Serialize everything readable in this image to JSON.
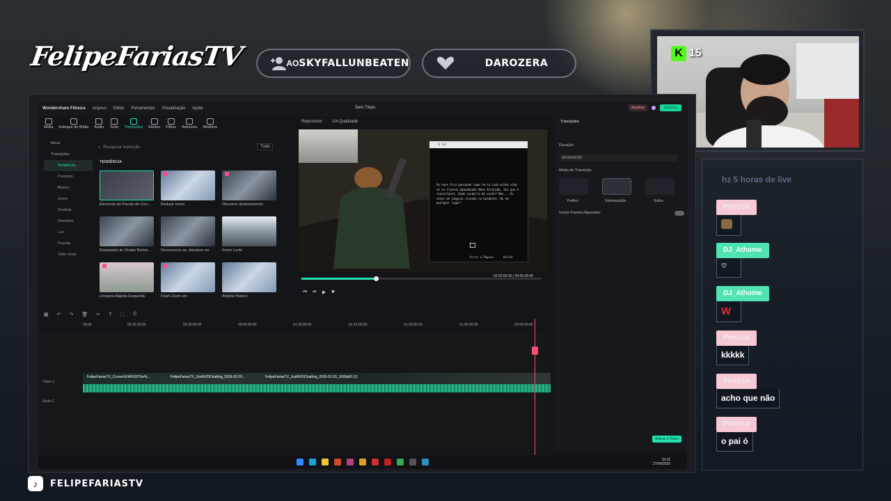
{
  "overlay": {
    "logo": "FelipeFariasTV",
    "sub_pill_prefix": "AO",
    "sub_pill_name": "SKYFALLUNBEATEN",
    "follow_pill_name": "DAROZERA",
    "kick_count": "15",
    "tiktok_handle": "FELIPEFARIASTV"
  },
  "editor": {
    "app_name": "Wondershare Filmora",
    "menu": [
      "Arquivo",
      "Editar",
      "Ferramentas",
      "Visualização",
      "Ajuda"
    ],
    "title": "Sem Título",
    "update_btn": "Atualizar",
    "export_btn": "Exportar",
    "tools": [
      "Mídia",
      "Estoque de Mídia",
      "Áudio",
      "Texto",
      "Transições",
      "Efeitos",
      "Filtros",
      "Adesivos",
      "Modelos"
    ],
    "active_tool": "Transições",
    "nav": {
      "mine": "Meus",
      "transitions": "Transições",
      "items": [
        "Tendência",
        "Premium",
        "Básico",
        "Zoom",
        "Deslizar",
        "Dissolver",
        "Luz",
        "Popular",
        "Slide show"
      ]
    },
    "search_placeholder": "Pesquisar transição",
    "search_filter": "Tudo",
    "section_title": "TENDÊNCIA",
    "tiles": [
      {
        "label": "Elemento do Pacote de Con..."
      },
      {
        "label": "Reduzir zoom"
      },
      {
        "label": "Dissolver desbotamento"
      },
      {
        "label": "Rastejador de Ondas Borbol..."
      },
      {
        "label": "Desvanecer-se, dissolver-se"
      },
      {
        "label": "Zoom Lento"
      },
      {
        "label": "Limpeza Rápida Esquerda"
      },
      {
        "label": "Flash Zoom em"
      },
      {
        "label": "Ampliar Básico"
      }
    ],
    "player": {
      "label": "Reprodutor",
      "quality": "1/4 Qualidade",
      "current": "02:02:56:06",
      "total": "/ 04:55:49:40",
      "popup_title": "- E Se?",
      "popup_text": "Se voce fica pensando como teria sido minha vida se eu tivesse abandonado Nova Alvorada. Sei que e inaceitável. Quem cuidaria de vocês? Mas... Às vezes me imagino vivendo no Guidente. Ou em qualquer lugar!",
      "popup_opt1": "Virar a Página",
      "popup_opt2": "Voltar"
    },
    "right_panel": {
      "tab": "Transições",
      "duration_label": "Duração",
      "duration_value": "00:00:00:52",
      "mode_label": "Modo de Transição",
      "modes": [
        "Prefixo",
        "Sobreposição",
        "Sufixo"
      ],
      "include_label": "Incluir Frames Aparados",
      "apply_all": "Aplicar a Todos"
    },
    "ruler": [
      "00:00",
      "00:15:00:00",
      "00:30:00:00",
      "00:45:00:00",
      "01:00:00:00",
      "01:15:00:00",
      "01:30:00:00",
      "01:45:00:00",
      "02:00:00:00"
    ],
    "clips": [
      "FelipeFariasTV_Cronos%3A%20The%...",
      "FelipeFariasTV_Just%20Chatting_2026-02-20...",
      "FelipeFariasTV_Just%20Chatting_2026-02-20_1080p60 (2)"
    ],
    "track_video": "Vídeo 1",
    "track_audio": "Áudio 1",
    "clock_time": "15:42",
    "clock_date": "27/04/2026"
  },
  "chat": {
    "top_text": "hz 5 horas de live",
    "messages": [
      {
        "user": "Phozi1a",
        "text": "",
        "kind": "pink",
        "emote": true
      },
      {
        "user": "DJ_Athome",
        "text": "♡",
        "kind": "green",
        "emote": false
      },
      {
        "user": "DJ_Athome",
        "text": "W",
        "kind": "green",
        "emote": false
      },
      {
        "user": "Phozi1a",
        "text": "kkkkk",
        "kind": "pink",
        "emote": false
      },
      {
        "user": "Phozi1a",
        "text": "acho que não",
        "kind": "pink",
        "emote": false
      },
      {
        "user": "Phozi1a",
        "text": "o pai ó",
        "kind": "pink",
        "emote": false
      }
    ]
  },
  "colors": {
    "accent": "#23e1b4",
    "kick_green": "#53fc18",
    "playhead": "#ff4d6d",
    "chat_pink": "#f6c9d4",
    "chat_green": "#4ee3b0"
  }
}
